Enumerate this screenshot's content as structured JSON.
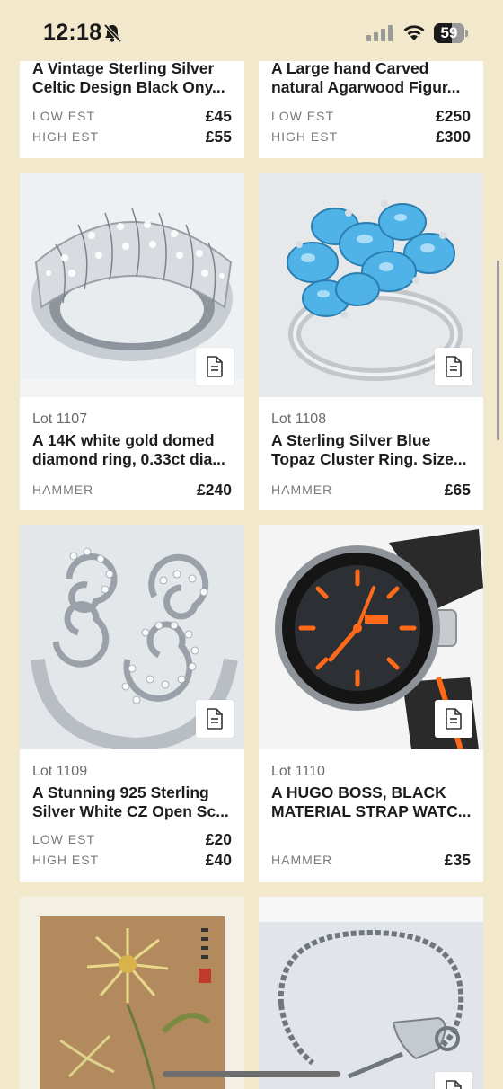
{
  "status_bar": {
    "time": "12:18",
    "battery": "59",
    "battery_level": 0.59
  },
  "labels": {
    "low_est": "LOW EST",
    "high_est": "HIGH EST",
    "hammer": "HAMMER"
  },
  "lots": [
    {
      "title_line1": "A Vintage Sterling Silver",
      "title_line2": "Celtic Design Black Ony...",
      "low_est": "£45",
      "high_est": "£55"
    },
    {
      "title_line1": "A Large hand Carved",
      "title_line2": "natural Agarwood Figur...",
      "low_est": "£250",
      "high_est": "£300"
    },
    {
      "lot": "Lot 1107",
      "title_line1": "A 14K white gold domed",
      "title_line2": "diamond ring, 0.33ct dia...",
      "hammer": "£240"
    },
    {
      "lot": "Lot 1108",
      "title_line1": "A Sterling Silver Blue",
      "title_line2": "Topaz Cluster Ring. Size...",
      "hammer": "£65"
    },
    {
      "lot": "Lot 1109",
      "title_line1": "A Stunning 925 Sterling",
      "title_line2": "Silver White CZ Open Sc...",
      "low_est": "£20",
      "high_est": "£40"
    },
    {
      "lot": "Lot 1110",
      "title_line1": "A HUGO BOSS, BLACK",
      "title_line2": "MATERIAL STRAP WATC...",
      "hammer": "£35"
    }
  ],
  "icons": {
    "bell": "bell-slash-icon",
    "signal": "cellular-signal-icon",
    "wifi": "wifi-icon",
    "battery": "battery-icon",
    "document": "document-icon"
  },
  "colors": {
    "background": "#f2e8cc",
    "card": "#ffffff",
    "watch_accent": "#ff6a1a",
    "topaz": "#4fb3e8"
  }
}
